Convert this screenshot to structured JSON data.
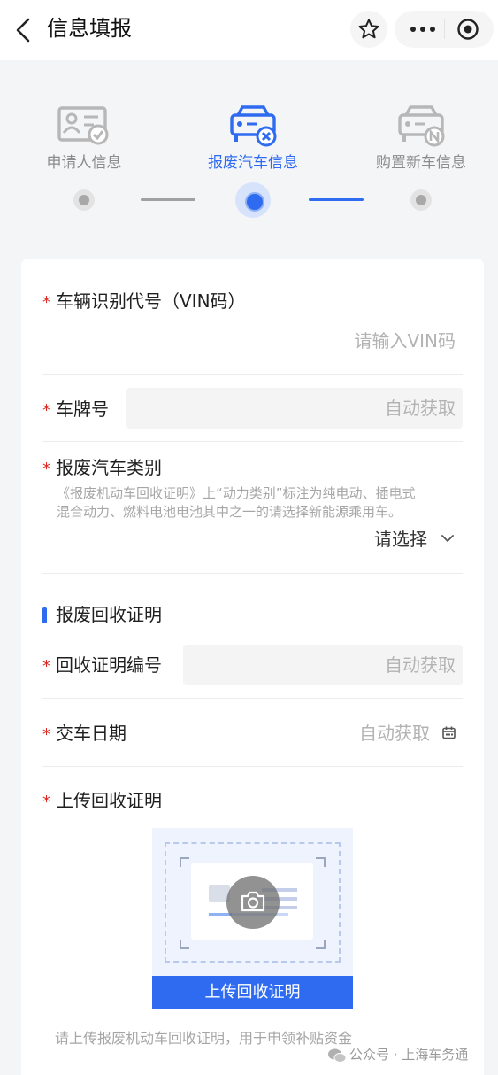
{
  "navbar": {
    "title": "信息填报",
    "icons": [
      "back-icon",
      "star-icon",
      "more-icon",
      "target-icon"
    ]
  },
  "steps": [
    {
      "label": "申请人信息",
      "icon": "id-card-check-icon",
      "state": "done"
    },
    {
      "label": "报废汽车信息",
      "icon": "car-x-icon",
      "state": "active"
    },
    {
      "label": "购置新车信息",
      "icon": "car-n-icon",
      "state": "pending"
    }
  ],
  "form": {
    "vin": {
      "required_mark": "*",
      "label": "车辆识别代号（VIN码）",
      "placeholder": "请输入VIN码"
    },
    "plate": {
      "required_mark": "*",
      "label": "车牌号",
      "value": "自动获取"
    },
    "scrap_type": {
      "required_mark": "*",
      "label": "报废汽车类别",
      "hint_line1": "《报废机动车回收证明》上“动力类别”标注为纯电动、插电式",
      "hint_line2": "混合动力、燃料电池电池其中之一的请选择新能源乘用车。",
      "selected": "请选择"
    },
    "section_title": "报废回收证明",
    "cert_no": {
      "required_mark": "*",
      "label": "回收证明编号",
      "value": "自动获取"
    },
    "delivery_date": {
      "required_mark": "*",
      "label": "交车日期",
      "value": "自动获取"
    },
    "upload": {
      "required_mark": "*",
      "label": "上传回收证明",
      "button": "上传回收证明",
      "hint": "请上传报废机动车回收证明，用于申领补贴资金"
    }
  },
  "watermark": "公众号 · 上海车务通",
  "colors": {
    "accent": "#2e6bf0",
    "required": "#e0261f"
  }
}
